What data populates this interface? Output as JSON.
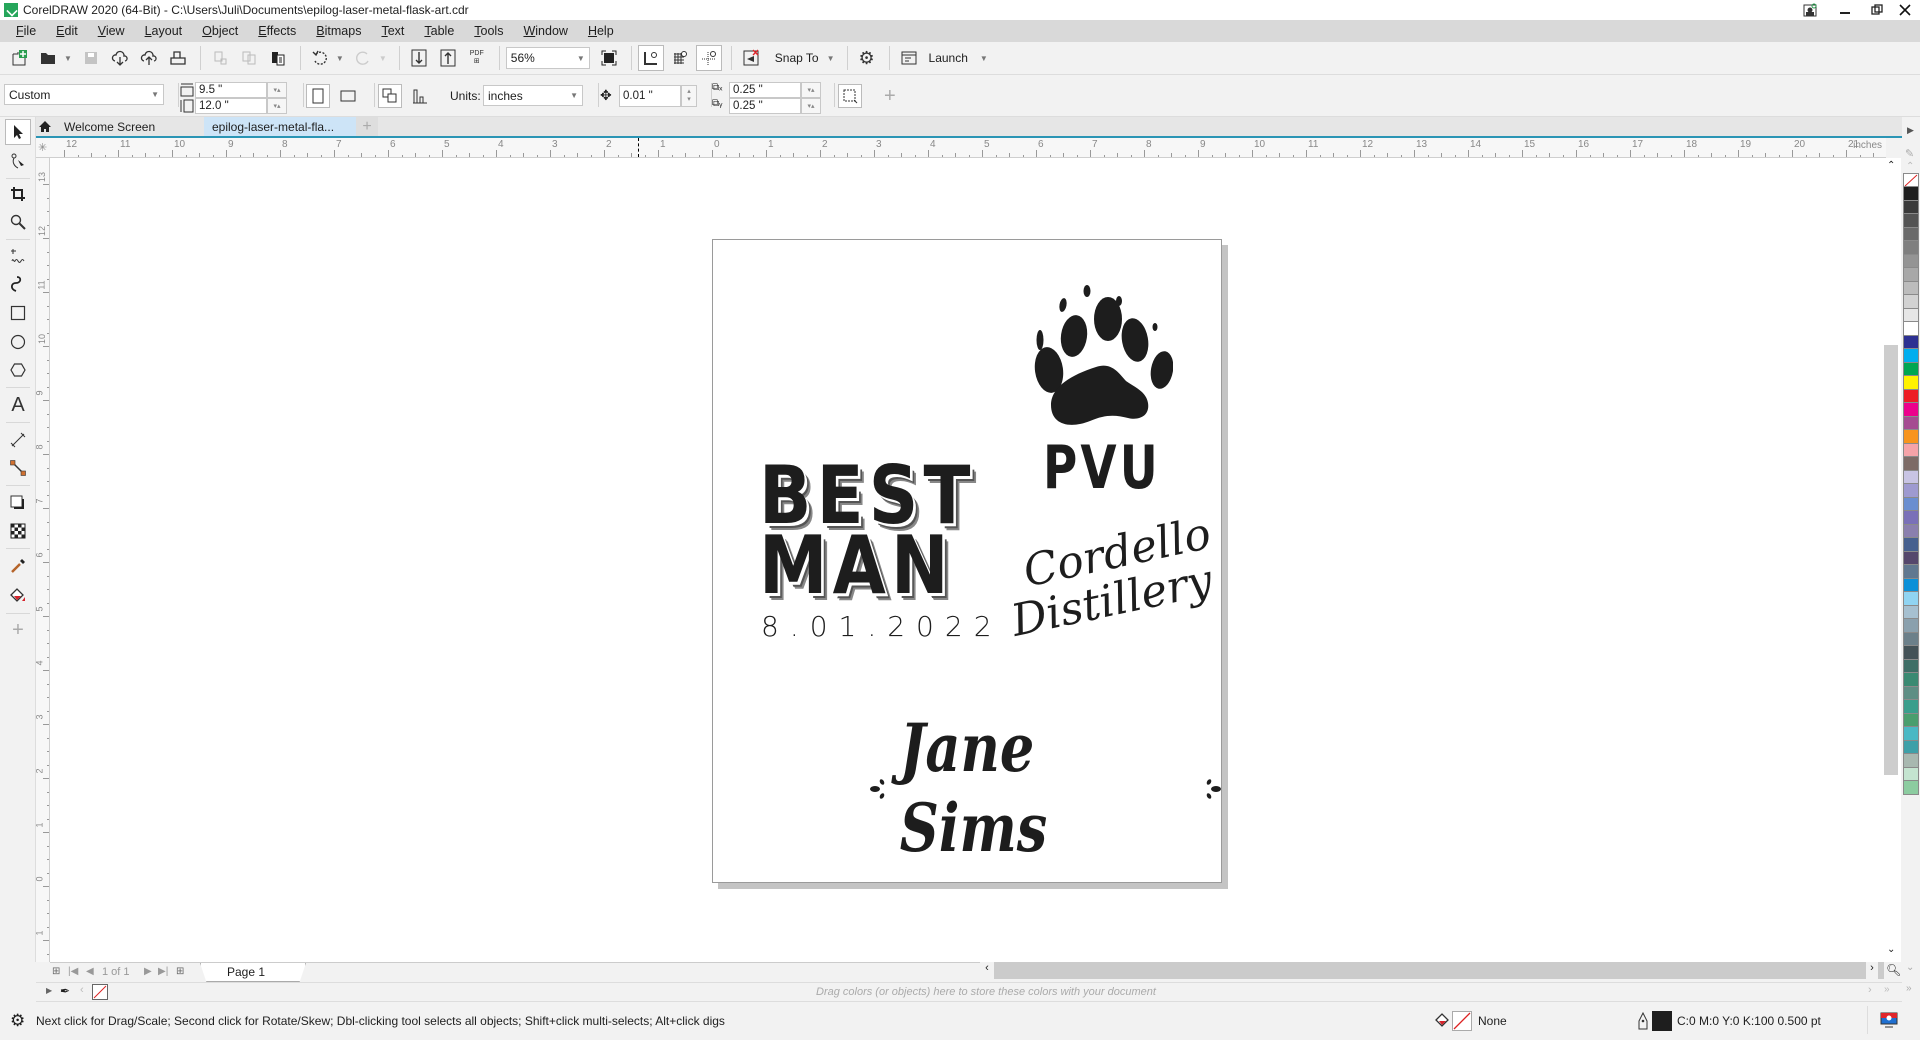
{
  "window": {
    "title": "CorelDRAW 2020 (64-Bit) - C:\\Users\\Juli\\Documents\\epilog-laser-metal-flask-art.cdr",
    "controls": [
      "user-login-icon",
      "minimize-icon",
      "restore-icon",
      "close-icon"
    ]
  },
  "menu": [
    "File",
    "Edit",
    "View",
    "Layout",
    "Object",
    "Effects",
    "Bitmaps",
    "Text",
    "Table",
    "Tools",
    "Window",
    "Help"
  ],
  "toolbar": {
    "zoom_level": "56%",
    "snap_to_label": "Snap To",
    "launch_label": "Launch",
    "pdf_label": "PDF"
  },
  "propbar": {
    "page_preset": "Custom",
    "page_width": "9.5 \"",
    "page_height": "12.0 \"",
    "units_label": "Units:",
    "units_value": "inches",
    "nudge_distance": "0.01 \"",
    "duplicate_x": "0.25 \"",
    "duplicate_y": "0.25 \""
  },
  "tabs": [
    {
      "label": "Welcome Screen",
      "active": false
    },
    {
      "label": "epilog-laser-metal-fla...",
      "active": true
    }
  ],
  "rulers": {
    "unit_label": "inches",
    "h_labels": [
      "12",
      "11",
      "10",
      "9",
      "8",
      "7",
      "6",
      "5",
      "4",
      "3",
      "2",
      "1",
      "0",
      "1",
      "2",
      "3",
      "4",
      "5",
      "6",
      "7",
      "8",
      "9",
      "10",
      "11",
      "12",
      "13",
      "14",
      "15",
      "16",
      "17",
      "18",
      "19",
      "20",
      "21"
    ],
    "v_labels": [
      "13",
      "12",
      "11",
      "10",
      "9",
      "8",
      "7",
      "6",
      "5",
      "4",
      "3",
      "2",
      "1",
      "0",
      "1"
    ]
  },
  "artwork": {
    "best": "BEST",
    "man": "MAN",
    "date": "8.01.2022",
    "pvu": "PVU",
    "cordello": "Cordello",
    "distillery": "Distillery",
    "jane_sims": "Jane Sims"
  },
  "page_nav": {
    "position": "1 of 1",
    "page_tab": "Page 1"
  },
  "document_palette": {
    "hint": "Drag colors (or objects) here to store these colors with your document"
  },
  "status": {
    "hint": "Next click for Drag/Scale; Second click for Rotate/Skew; Dbl-clicking tool selects all objects; Shift+click multi-selects; Alt+click digs",
    "fill_label": "None",
    "outline_label": "C:0 M:0 Y:0 K:100  0.500 pt"
  },
  "palette_colors": [
    "#1e1e1e",
    "#3a3a3a",
    "#545454",
    "#6a6a6a",
    "#7f7f7f",
    "#949494",
    "#a8a8a8",
    "#bcbcbc",
    "#d2d2d2",
    "#e6e6e6",
    "#ffffff",
    "#2d3192",
    "#00aeef",
    "#00a651",
    "#fff200",
    "#ed1c24",
    "#ec008c",
    "#a54b91",
    "#f7941d",
    "#f5a3a8",
    "#7d6b66",
    "#c8c4e4",
    "#9e9ad0",
    "#6a8ed0",
    "#7a70b8",
    "#8a7fae",
    "#46608f",
    "#55476c",
    "#607890",
    "#0b90d8",
    "#90d4f2",
    "#a6c0d0",
    "#8aa0ad",
    "#6c808a",
    "#445257",
    "#3e6e66",
    "#3a8a72",
    "#5e8e84",
    "#3a9e8c",
    "#4a9e6e",
    "#4ab8c4",
    "#3ea0a8",
    "#a8b8b0",
    "#c4e4d0",
    "#8ccca0"
  ]
}
